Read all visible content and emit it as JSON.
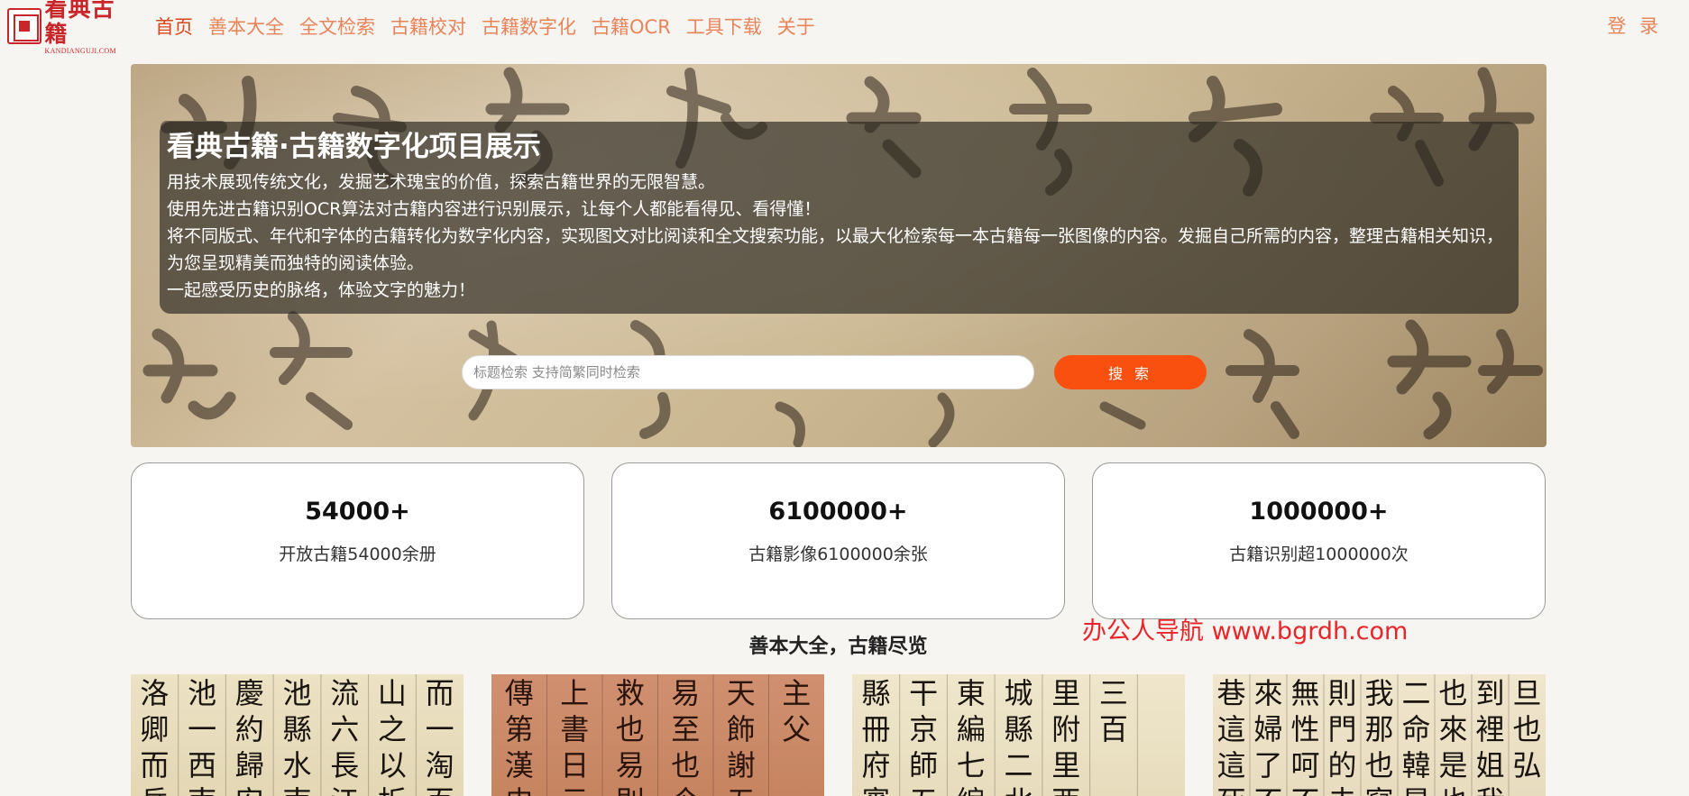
{
  "logo": {
    "name_cn": "看典古籍",
    "name_en": "KANDIANGUJI.COM"
  },
  "nav": {
    "items": [
      "首页",
      "善本大全",
      "全文检索",
      "古籍校对",
      "古籍数字化",
      "古籍OCR",
      "工具下载",
      "关于"
    ],
    "active_index": 0,
    "login": "登 录"
  },
  "hero": {
    "title": "看典古籍·古籍数字化项目展示",
    "lines": [
      "用技术展现传统文化，发掘艺术瑰宝的价值，探索古籍世界的无限智慧。",
      "使用先进古籍识别OCR算法对古籍内容进行识别展示，让每个人都能看得见、看得懂！",
      "将不同版式、年代和字体的古籍转化为数字化内容，实现图文对比阅读和全文搜索功能，以最大化检索每一本古籍每一张图像的内容。发掘自己所需的内容，整理古籍相关知识，为您呈现精美而独特的阅读体验。",
      "一起感受历史的脉络，体验文字的魅力！"
    ],
    "search": {
      "placeholder": "标题检索 支持简繁同时检索",
      "value": "",
      "button": "搜 索"
    }
  },
  "stats": [
    {
      "value": "54000+",
      "label": "开放古籍54000余册"
    },
    {
      "value": "6100000+",
      "label": "古籍影像6100000余张"
    },
    {
      "value": "1000000+",
      "label": "古籍识别超1000000次"
    }
  ],
  "section": {
    "title": "善本大全，古籍尽览"
  },
  "watermark": "办公人导航 www.bgrdh.com",
  "colors": {
    "nav_text": "#e8845a",
    "nav_active": "#d9461a",
    "search_button": "#fa500f",
    "brand_red": "#c8262a",
    "watermark": "#e8262a"
  },
  "thumbnails": [
    {
      "glyphs": [
        "洛",
        "卿",
        "而",
        "岳",
        "池",
        "一",
        "西",
        "南",
        "慶",
        "約",
        "歸",
        "安",
        "池",
        "縣",
        "水",
        "南",
        "流",
        "六",
        "長",
        "江",
        "山",
        "之",
        "以",
        "折",
        "而",
        "一",
        "淘",
        "百"
      ]
    },
    {
      "glyphs": [
        "傳",
        "第",
        "漢",
        "史",
        "上",
        "書",
        "日",
        "云",
        "救",
        "也",
        "易",
        "則",
        "易",
        "至",
        "也",
        "今",
        "天",
        "飾",
        "謝",
        "五",
        "主",
        "父"
      ]
    },
    {
      "glyphs": [
        "縣",
        "冊",
        "府",
        "賓",
        "干",
        "京",
        "師",
        "五",
        "東",
        "編",
        "七",
        "編",
        "城",
        "縣",
        "二",
        "北",
        "里",
        "附",
        "里",
        "西",
        "三",
        "百"
      ]
    },
    {
      "glyphs": [
        "巷",
        "這",
        "這",
        "死",
        "來",
        "婦",
        "了",
        "不",
        "無",
        "性",
        "呵",
        "不",
        "則",
        "門",
        "的",
        "去",
        "我",
        "那",
        "也",
        "寫",
        "二",
        "命",
        "韓",
        "是",
        "也",
        "來",
        "是",
        "也",
        "到",
        "裡",
        "姐",
        "我",
        "旦",
        "也",
        "弘"
      ]
    }
  ]
}
